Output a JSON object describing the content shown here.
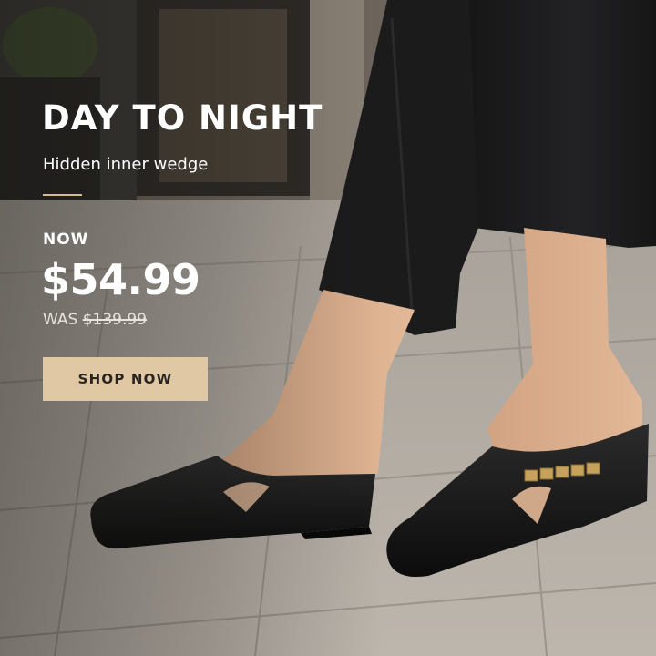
{
  "ad": {
    "headline": "DAY TO NIGHT",
    "subline": "Hidden inner wedge",
    "now_label": "NOW",
    "now_price": "$54.99",
    "was_label": "WAS",
    "was_price": "$139.99",
    "cta_label": "SHOP NOW"
  },
  "colors": {
    "accent": "#e1c8a4",
    "cta_text": "#2a2520",
    "headline_text": "#ffffff",
    "shoe": "#141414",
    "pants": "#1b1b1c",
    "pavement": "#b9b2aa"
  }
}
